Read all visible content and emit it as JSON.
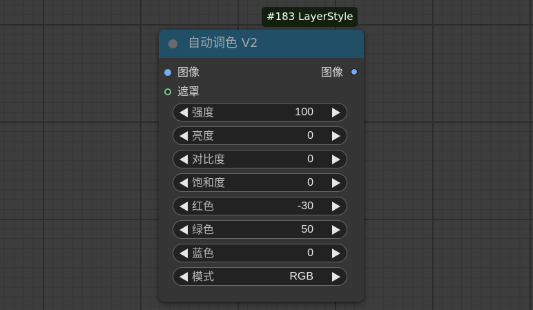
{
  "badge": "#183 LayerStyle",
  "node": {
    "title": "自动调色 V2",
    "inputs": [
      {
        "label": "图像",
        "color": "#6fb0f0"
      },
      {
        "label": "遮罩",
        "color": "#80c080"
      }
    ],
    "outputs": [
      {
        "label": "图像",
        "color": "#6fb0f0"
      }
    ],
    "widgets": [
      {
        "label": "强度",
        "value": "100"
      },
      {
        "label": "亮度",
        "value": "0"
      },
      {
        "label": "对比度",
        "value": "0"
      },
      {
        "label": "饱和度",
        "value": "0"
      },
      {
        "label": "红色",
        "value": "-30"
      },
      {
        "label": "绿色",
        "value": "50"
      },
      {
        "label": "蓝色",
        "value": "0"
      },
      {
        "label": "模式",
        "value": "RGB"
      }
    ]
  }
}
